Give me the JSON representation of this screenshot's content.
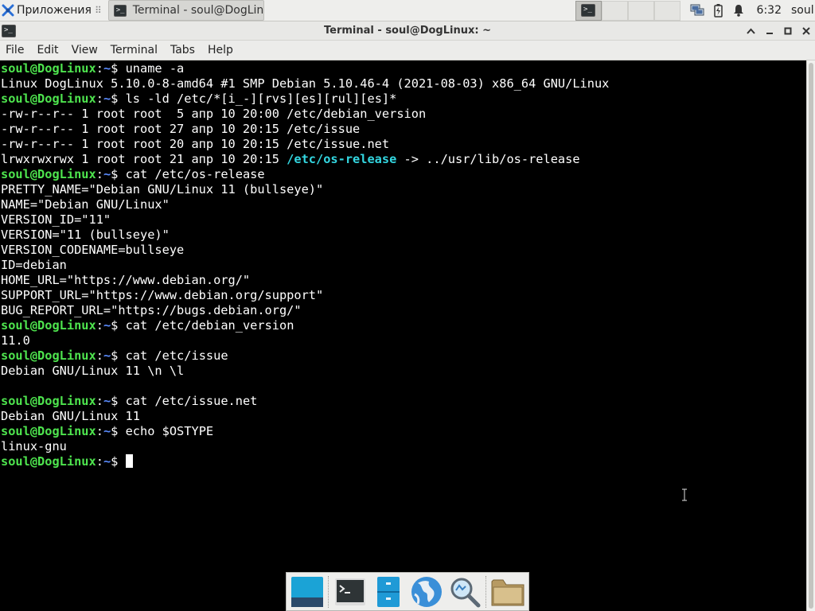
{
  "panel": {
    "apps_label": "Приложения",
    "task_label": "Terminal - soul@DogLin...",
    "clock": "6:32",
    "user": "soul",
    "icons": [
      "xfce-mouse-icon",
      "terminal-icon",
      "network-icon",
      "battery-icon",
      "notification-bell-icon"
    ]
  },
  "window": {
    "title": "Terminal - soul@DogLinux: ~",
    "controls": [
      "up-arrow-icon",
      "minimize-icon",
      "maximize-icon",
      "close-icon"
    ]
  },
  "menubar": {
    "items": [
      "File",
      "Edit",
      "View",
      "Terminal",
      "Tabs",
      "Help"
    ]
  },
  "terminal": {
    "prompt_user": "soul@DogLinux",
    "prompt_path": "~",
    "lines": [
      {
        "type": "prompt",
        "cmd": "uname -a"
      },
      {
        "type": "out",
        "text": "Linux DogLinux 5.10.0-8-amd64 #1 SMP Debian 5.10.46-4 (2021-08-03) x86_64 GNU/Linux"
      },
      {
        "type": "prompt",
        "cmd": "ls -ld /etc/*[i_-][rvs][es][rul][es]*"
      },
      {
        "type": "out",
        "text": "-rw-r--r-- 1 root root  5 апр 10 20:00 /etc/debian_version"
      },
      {
        "type": "out",
        "text": "-rw-r--r-- 1 root root 27 апр 10 20:15 /etc/issue"
      },
      {
        "type": "out",
        "text": "-rw-r--r-- 1 root root 20 апр 10 20:15 /etc/issue.net"
      },
      {
        "type": "link",
        "pre": "lrwxrwxrwx 1 root root 21 апр 10 20:15 ",
        "name": "/etc/os-release",
        "post": " -> ../usr/lib/os-release"
      },
      {
        "type": "prompt",
        "cmd": "cat /etc/os-release"
      },
      {
        "type": "out",
        "text": "PRETTY_NAME=\"Debian GNU/Linux 11 (bullseye)\""
      },
      {
        "type": "out",
        "text": "NAME=\"Debian GNU/Linux\""
      },
      {
        "type": "out",
        "text": "VERSION_ID=\"11\""
      },
      {
        "type": "out",
        "text": "VERSION=\"11 (bullseye)\""
      },
      {
        "type": "out",
        "text": "VERSION_CODENAME=bullseye"
      },
      {
        "type": "out",
        "text": "ID=debian"
      },
      {
        "type": "out",
        "text": "HOME_URL=\"https://www.debian.org/\""
      },
      {
        "type": "out",
        "text": "SUPPORT_URL=\"https://www.debian.org/support\""
      },
      {
        "type": "out",
        "text": "BUG_REPORT_URL=\"https://bugs.debian.org/\""
      },
      {
        "type": "prompt",
        "cmd": "cat /etc/debian_version"
      },
      {
        "type": "out",
        "text": "11.0"
      },
      {
        "type": "prompt",
        "cmd": "cat /etc/issue"
      },
      {
        "type": "out",
        "text": "Debian GNU/Linux 11 \\n \\l"
      },
      {
        "type": "out",
        "text": ""
      },
      {
        "type": "prompt",
        "cmd": "cat /etc/issue.net"
      },
      {
        "type": "out",
        "text": "Debian GNU/Linux 11"
      },
      {
        "type": "prompt",
        "cmd": "echo $OSTYPE"
      },
      {
        "type": "out",
        "text": "linux-gnu"
      },
      {
        "type": "prompt",
        "cmd": "",
        "cursor": true
      }
    ]
  },
  "dock": {
    "items": [
      "show-desktop-icon",
      "terminal-icon",
      "file-cabinet-icon",
      "web-browser-globe-icon",
      "app-finder-magnifier-icon",
      "folder-icon"
    ]
  },
  "colors": {
    "prompt_user": "#4ee44e",
    "prompt_path": "#5b8cff",
    "symlink": "#33d6e0",
    "terminal_bg": "#000000",
    "terminal_fg": "#ffffff",
    "panel_bg": "#eeeeec"
  }
}
